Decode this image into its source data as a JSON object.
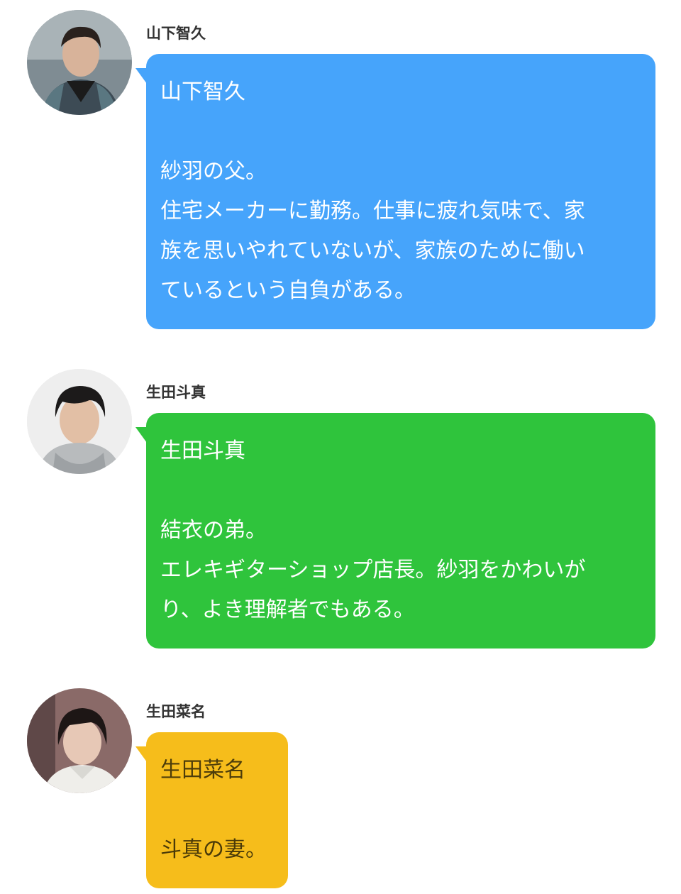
{
  "entries": [
    {
      "avatar_icon": "person-photo-icon",
      "name": "山下智久",
      "bubble_color": "#46a4fb",
      "title": "山下智久",
      "lines": [
        "紗羽の父。",
        "住宅メーカーに勤務。仕事に疲れ気味で、家",
        "族を思いやれていないが、家族のために働い",
        "ているという自負がある。"
      ]
    },
    {
      "avatar_icon": "person-photo-icon",
      "name": "生田斗真",
      "bubble_color": "#2fc43c",
      "title": "生田斗真",
      "lines": [
        "結衣の弟。",
        "エレキギターショップ店長。紗羽をかわいが",
        "り、よき理解者でもある。"
      ]
    },
    {
      "avatar_icon": "person-photo-icon",
      "name": "生田菜名",
      "bubble_color": "#f6bd1b",
      "title": "生田菜名",
      "lines": [
        "斗真の妻。"
      ]
    }
  ]
}
